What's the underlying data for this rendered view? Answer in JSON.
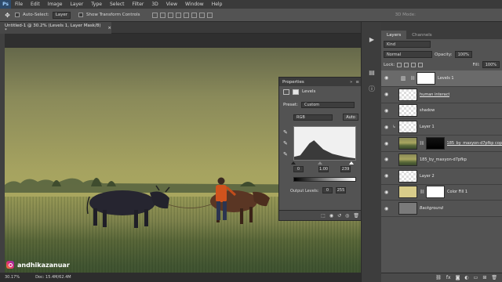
{
  "menu": [
    "File",
    "Edit",
    "Image",
    "Layer",
    "Type",
    "Select",
    "Filter",
    "3D",
    "View",
    "Window",
    "Help"
  ],
  "app_logo": "Ps",
  "options_bar": {
    "auto_select_label": "Auto-Select:",
    "auto_select_value": "Layer",
    "show_transform_label": "Show Transform Controls",
    "mode_3d_label": "3D Mode:"
  },
  "document_tab": {
    "title": "Untitled-1 @ 30.2% (Levels 1, Layer Mask/8) *",
    "close_glyph": "×"
  },
  "status_bar": {
    "zoom": "30.17%",
    "doc": "Doc: 15.4M/62.4M"
  },
  "watermark": {
    "handle": "andhikazanuar",
    "icon": "instagram-icon"
  },
  "properties": {
    "panel_title": "Properties",
    "adjustment_name": "Levels",
    "preset_label": "Preset:",
    "preset_value": "Custom",
    "channel_value": "RGB",
    "auto_label": "Auto",
    "input_levels": {
      "shadow": "0",
      "midtone": "1.00",
      "highlight": "239"
    },
    "output_levels_label": "Output Levels:",
    "output_levels": {
      "low": "0",
      "high": "255"
    }
  },
  "layers_panel": {
    "tabs": [
      "Layers",
      "Channels"
    ],
    "kind_label": "Kind",
    "blend_mode": "Normal",
    "opacity_label": "Opacity:",
    "opacity_value": "100%",
    "lock_label": "Lock:",
    "fill_label": "Fill:",
    "fill_value": "100%",
    "layers": [
      {
        "name": "Levels 1",
        "thumb": "adjustment",
        "mask": "white",
        "selected": true,
        "linked": false
      },
      {
        "name": "human interact",
        "thumb": "checker",
        "selected": false,
        "linked": false
      },
      {
        "name": "shadow",
        "thumb": "checker",
        "selected": false,
        "linked": false
      },
      {
        "name": "Layer 1",
        "thumb": "checker",
        "selected": false,
        "linked": true
      },
      {
        "name": "185_by_maxyon-d7pfkp copy",
        "thumb": "photo",
        "mask": "black",
        "selected": false,
        "linked": false
      },
      {
        "name": "185_by_maxyon-d7pfkp",
        "thumb": "photo",
        "selected": false,
        "linked": false
      },
      {
        "name": "Layer 2",
        "thumb": "checker",
        "selected": false,
        "linked": false
      },
      {
        "name": "Color Fill 1",
        "thumb": "yellow",
        "mask": "white",
        "selected": false,
        "linked": false
      },
      {
        "name": "Background",
        "thumb": "gray",
        "selected": false,
        "linked": false,
        "italic": true
      }
    ]
  }
}
